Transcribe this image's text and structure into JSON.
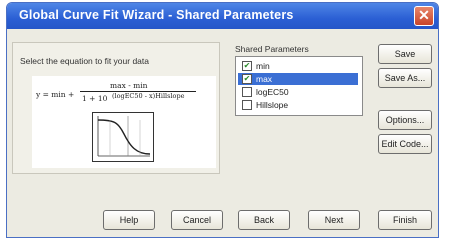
{
  "window": {
    "title": "Global Curve Fit Wizard - Shared Parameters"
  },
  "equation_panel": {
    "prompt": "Select the equation to fit your data",
    "equation": {
      "lhs": "y = min +",
      "numerator": "max - min",
      "denominator": "1 + 10",
      "exponent": "(logEC50 - x)Hillslope"
    }
  },
  "shared_parameters": {
    "label": "Shared Parameters",
    "items": [
      {
        "label": "min",
        "checked": true,
        "selected": false
      },
      {
        "label": "max",
        "checked": true,
        "selected": true
      },
      {
        "label": "logEC50",
        "checked": false,
        "selected": false
      },
      {
        "label": "Hillslope",
        "checked": false,
        "selected": false
      }
    ]
  },
  "side_buttons": {
    "save": "Save",
    "save_as": "Save As...",
    "options": "Options...",
    "edit_code": "Edit Code..."
  },
  "bottom_buttons": {
    "help": "Help",
    "cancel": "Cancel",
    "back": "Back",
    "next": "Next",
    "finish": "Finish"
  },
  "colors": {
    "titlebar": "#2b5fd4",
    "selection": "#3b6fd4",
    "dialog_bg": "#ecebe2",
    "close": "#c8442a"
  }
}
